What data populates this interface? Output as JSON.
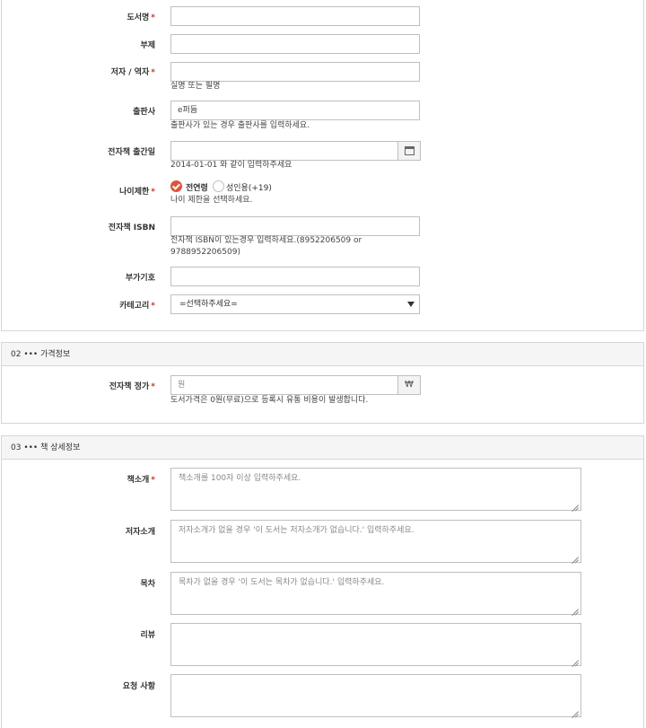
{
  "section1": {
    "title": {
      "label": "도서명",
      "required": "*"
    },
    "subtitle": {
      "label": "부제"
    },
    "author": {
      "label": "저자 / 역자",
      "required": "*",
      "help": "실명 또는 필명"
    },
    "publisher": {
      "label": "출판사",
      "value": "e퍼듐",
      "help": "출판사가 있는 경우 출판사를 입력하세요."
    },
    "pubdate": {
      "label": "전자책 출간일",
      "help": "2014-01-01 와 같이 입력하주세요",
      "icon": "calendar-icon"
    },
    "age": {
      "label": "나이제한",
      "required": "*",
      "options": [
        "전연령",
        "성인용(+19)"
      ],
      "selected": "전연령",
      "help": "나이 제한을 선택하세요."
    },
    "isbn": {
      "label": "전자책 ISBN",
      "help_line1": "전자책 ISBN이 있는경우 입력하세요.(8952206509 or",
      "help_line2": "9788952206509)"
    },
    "extra_code": {
      "label": "부가기호"
    },
    "category": {
      "label": "카테고리",
      "required": "*",
      "selected": "=선택하주세요="
    }
  },
  "section2": {
    "header": "02 ••• 가격정보",
    "price": {
      "label": "전자책 정가",
      "required": "*",
      "placeholder": "원",
      "currency": "₩",
      "help": "도서가격은 0원(무료)으로 등록시 유통 비용이 발생합니다."
    }
  },
  "section3": {
    "header": "03 ••• 책 상세정보",
    "intro": {
      "label": "책소개",
      "required": "*",
      "placeholder": "책소개를 100자 이상 입력하주세요."
    },
    "author_intro": {
      "label": "저자소개",
      "placeholder": "저자소개가 없을 경우 '이 도서는 저자소개가 없습니다.' 입력하주세요."
    },
    "toc": {
      "label": "목차",
      "placeholder": "목차가 없을 경우 '이 도서는 목차가 없습니다.' 입력하주세요."
    },
    "review": {
      "label": "리뷰",
      "placeholder": ""
    },
    "request": {
      "label": "요청 사항",
      "placeholder": ""
    }
  }
}
